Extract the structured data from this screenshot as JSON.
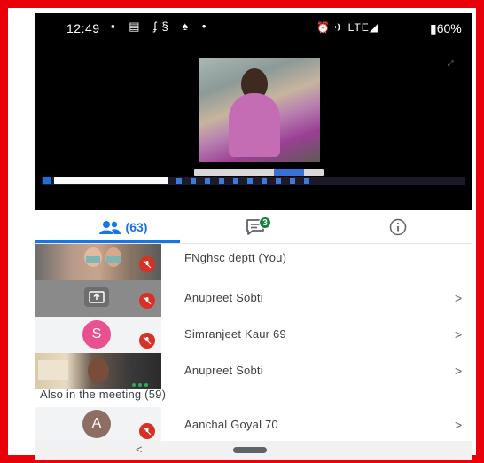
{
  "status_bar": {
    "time": "12:49",
    "left_icons": "▪ ▤ ʄ§ ♠ •",
    "right_icons": "⏰ ✈ LTE◢",
    "battery": "▮60%"
  },
  "tabs": {
    "people_count": "(63)",
    "chat_badge": "3"
  },
  "participants": [
    {
      "name": "FNghsc deptt (You)",
      "thumb": "video",
      "muted": true
    },
    {
      "name": "Anupreet Sobti",
      "thumb": "presenting",
      "muted": true
    },
    {
      "name": "Simranjeet Kaur 69",
      "thumb": "avatar",
      "avatar_letter": "S",
      "avatar_color": "#e8508f",
      "muted": true
    },
    {
      "name": "Anupreet Sobti",
      "thumb": "video",
      "muted": false
    }
  ],
  "also_in_meeting": {
    "label": "Also in the meeting (59)",
    "participants": [
      {
        "name": "Aanchal Goyal 70",
        "avatar_letter": "A",
        "avatar_color": "#8d6e63",
        "muted": true
      }
    ]
  },
  "chevron": ">",
  "nav": {
    "back": "<"
  },
  "colors": {
    "frame": "#e8000b",
    "accent": "#1a73e8",
    "mute": "#d93025",
    "chat_badge": "#188038"
  }
}
